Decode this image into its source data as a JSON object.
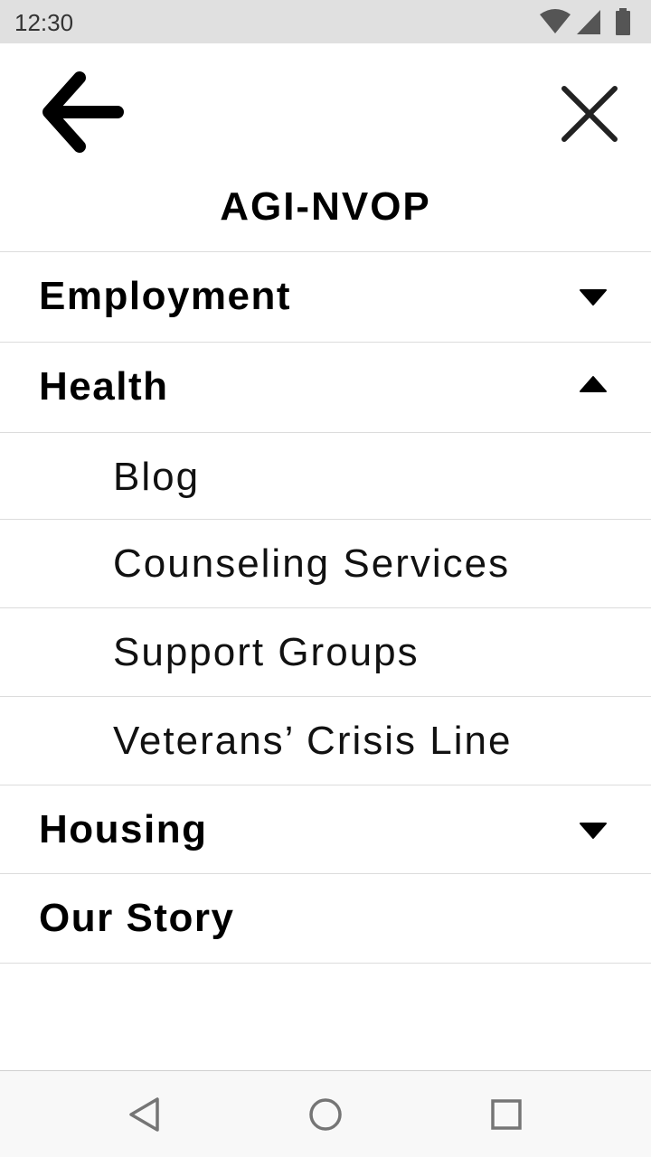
{
  "status_bar": {
    "time": "12:30",
    "icons": [
      "wifi-icon",
      "signal-icon",
      "battery-icon"
    ]
  },
  "header": {
    "back_icon": "arrow-left-icon",
    "close_icon": "close-icon",
    "title": "AGI-NVOP"
  },
  "menu": {
    "items": [
      {
        "label": "Employment",
        "type": "section",
        "expanded": false
      },
      {
        "label": "Health",
        "type": "section",
        "expanded": true
      },
      {
        "label": "Blog",
        "type": "subitem"
      },
      {
        "label": "Counseling Services",
        "type": "subitem"
      },
      {
        "label": "Support Groups",
        "type": "subitem"
      },
      {
        "label": "Veterans’ Crisis Line",
        "type": "subitem"
      },
      {
        "label": "Housing",
        "type": "section",
        "expanded": false
      },
      {
        "label": "Our Story",
        "type": "link"
      }
    ]
  },
  "nav_bar": {
    "icons": [
      "back-triangle-icon",
      "home-circle-icon",
      "recents-square-icon"
    ]
  },
  "colors": {
    "status_bar_bg": "#e0e0e0",
    "divider": "#dcdcdc",
    "text": "#000000"
  }
}
